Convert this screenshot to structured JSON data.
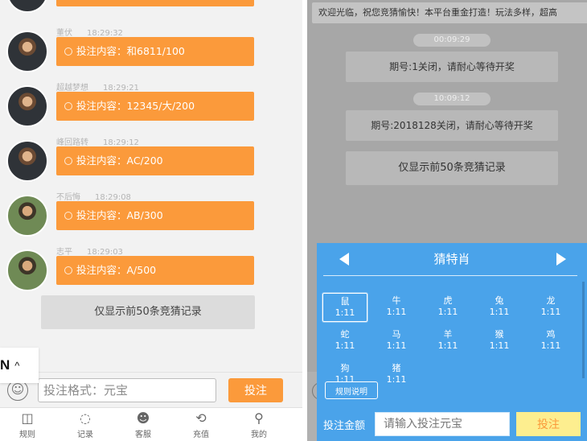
{
  "chat": {
    "messages": [
      {
        "name": "董伏",
        "time": "18:29:32",
        "content": "投注内容：和6811/100"
      },
      {
        "name": "超越梦想",
        "time": "18:29:21",
        "content": "投注内容：12345/大/200"
      },
      {
        "name": "峰回路转",
        "time": "18:29:12",
        "content": "投注内容：AC/200"
      },
      {
        "name": "不后悔",
        "time": "18:29:08",
        "content": "投注内容：AB/300"
      },
      {
        "name": "志平",
        "time": "18:29:03",
        "content": "投注内容：A/500"
      }
    ],
    "notice": "仅显示前50条竞猜记录"
  },
  "lang": {
    "code": "N",
    "chevron": "^"
  },
  "input": {
    "placeholder": "投注格式：元宝",
    "submit": "投注",
    "emoji_glyph": "☺"
  },
  "tabbar": [
    {
      "label": "规则",
      "icon": "book-icon",
      "glyph": "◫"
    },
    {
      "label": "记录",
      "icon": "search-icon",
      "glyph": "◌"
    },
    {
      "label": "客服",
      "icon": "support-icon",
      "glyph": "☻"
    },
    {
      "label": "充值",
      "icon": "recharge-icon",
      "glyph": "⟲"
    },
    {
      "label": "我的",
      "icon": "user-icon",
      "glyph": "⚲"
    }
  ],
  "right": {
    "marquee": "欢迎光临，祝您竞猜愉快！本平台重金打造！玩法多样，超高",
    "events": [
      {
        "time": "00:09:29",
        "text": "期号:1关闭，请耐心等待开奖"
      },
      {
        "time": "10:09:12",
        "text": "期号:2018128关闭，请耐心等待开奖"
      }
    ],
    "notice": "仅显示前50条竞猜记录"
  },
  "zodiac": {
    "title": "猜特肖",
    "odds": "1:11",
    "animals": [
      "鼠",
      "牛",
      "虎",
      "兔",
      "龙",
      "蛇",
      "马",
      "羊",
      "猴",
      "鸡",
      "狗",
      "猪"
    ],
    "selected": "鼠",
    "rules_label": "规则说明",
    "amount_label": "投注金额",
    "amount_placeholder": "请输入投注元宝",
    "bet_label": "投注"
  },
  "colors": {
    "accent": "#fb9a3b",
    "panel_blue": "#4aa3ea",
    "bet_yellow": "#fdee8f"
  }
}
